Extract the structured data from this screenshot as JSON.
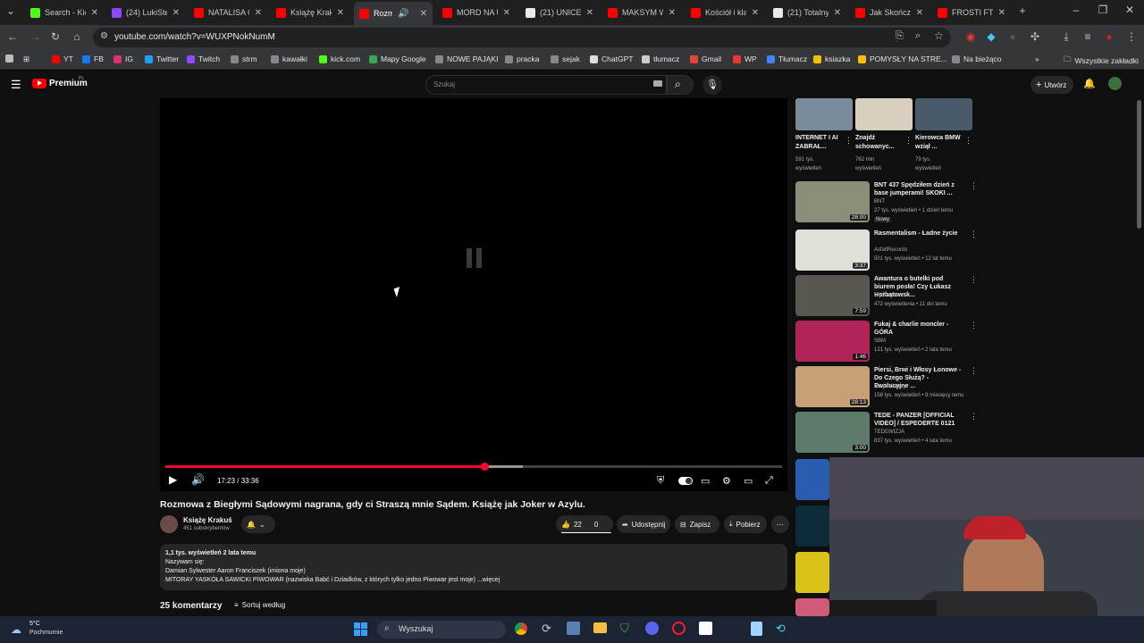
{
  "browser": {
    "tabs": [
      {
        "title": "Search - Kick",
        "color": "#53fc18"
      },
      {
        "title": "(24) LukiStev",
        "color": "#9146ff"
      },
      {
        "title": "NATALISA O",
        "color": "#ff0000"
      },
      {
        "title": "Książę Krakuś",
        "color": "#ff0000"
      },
      {
        "title": "Rozmow",
        "color": "#ff0000",
        "active": true
      },
      {
        "title": "MORD NA U",
        "color": "#ff0000"
      },
      {
        "title": "(21) UNICEF",
        "color": "#e7e9ea"
      },
      {
        "title": "MAKSYM W",
        "color": "#ff0000"
      },
      {
        "title": "Kościół i klas",
        "color": "#ff0000"
      },
      {
        "title": "(21) Totalny",
        "color": "#e7e9ea"
      },
      {
        "title": "Jak Skończył",
        "color": "#ff0000"
      },
      {
        "title": "FROSTI FT. F",
        "color": "#ff0000"
      }
    ],
    "url": "youtube.com/watch?v=WUXPNokNumM",
    "bookmarks": [
      "YT",
      "FB",
      "IG",
      "Twitter",
      "Twitch",
      "strm",
      "kawałki",
      "kick.com",
      "Mapy Google",
      "NOWE PAJĄKI",
      "pracka",
      "sejak",
      "ChatGPT",
      "tłumacz",
      "Gmail",
      "WP",
      "Tłumacz",
      "ksiazka",
      "POMYSŁY NA STRE...",
      "Na bieżąco"
    ],
    "all_bookmarks": "Wszystkie zakładki"
  },
  "youtube": {
    "logo_label": "Premium",
    "logo_region": "PL",
    "search_placeholder": "Szukaj",
    "create_label": "Utwórz",
    "player": {
      "time": "17:23 / 33:36",
      "progress": 0.517,
      "buffered": 0.58
    },
    "video": {
      "title": "Rozmowa z Biegłymi Sądowymi nagrana, gdy ci Straszą mnie Sądem. Książę jak Joker w Azylu.",
      "channel": "Książę Krakuś",
      "subscribers": "451 subskrybentów",
      "likes": "22",
      "dislikes": "0",
      "share": "Udostępnij",
      "save": "Zapisz",
      "download": "Pobierz"
    },
    "description": {
      "stats": "1,1 tys. wyświetleń  2 lata temu",
      "line1": "Nazywam się:",
      "line2": "Damian Sylwester Aaron Franciszek (imiona moje)",
      "line3": "MITORAY YASKÓŁA SAWICKI PIWOWAR (nazwiska Babć i Dziadków, z których tylko jedno Piwowar jest moje) ...więcej"
    },
    "comments_count": "25 komentarzy",
    "sort_label": "Sortuj według",
    "shorts": [
      {
        "title": "INTERNET I AI ZABRAŁ...",
        "views": "591 tys. wyświetleń"
      },
      {
        "title": "Znajdź schowanyc...",
        "views": "762 mln wyświetleń"
      },
      {
        "title": "Kierowca BMW wziął ...",
        "views": "79 tys. wyświetleń"
      }
    ],
    "recommendations": [
      {
        "title": "BNT 437 Spędziłem dzień z base jumperami! SKOKI ...",
        "channel": "BNT",
        "meta": "27 tys. wyświetleń • 1 dzień temu",
        "badge": "Nowy",
        "duration": "28:00",
        "thumb": "#8a8f7a"
      },
      {
        "title": "Rasmentalism - Ładne życie",
        "channel": "AsfaltRecords",
        "meta": "501 tys. wyświetleń • 12 lat temu",
        "badge": "",
        "duration": "3:37",
        "thumb": "#e0e0d8"
      },
      {
        "title": "Awantura o butelki pod biurem posła! Czy Łukasz Horbatowsk...",
        "channel": "MyGlogow",
        "meta": "472 wyświetlenia • 11 dni temu",
        "badge": "",
        "duration": "7:59",
        "thumb": "#5a5650"
      },
      {
        "title": "Fukaj & charlie moncler - GÓRA",
        "channel": "SBM",
        "meta": "121 tys. wyświetleń • 2 lata temu",
        "badge": "",
        "duration": "1:46",
        "thumb": "#b0245a"
      },
      {
        "title": "Piersi, Brwi i Włosy Łonowe - Do Czego Służą? - Ewolucyjne ...",
        "channel": "Magia Natury",
        "meta": "158 tys. wyświetleń • 9 miesięcy temu",
        "badge": "",
        "duration": "28:13",
        "thumb": "#c8a078"
      },
      {
        "title": "TEDE - PANZER [OFFICIAL VIDEO] / ESPEOERTE 0121",
        "channel": "TEDEWIZJA",
        "meta": "837 tys. wyświetleń • 4 lata temu",
        "badge": "",
        "duration": "3:00",
        "thumb": "#5e7a6a"
      }
    ]
  },
  "taskbar": {
    "temperature": "5°C",
    "weather": "Pochmurnie",
    "search": "Wyszukaj"
  }
}
